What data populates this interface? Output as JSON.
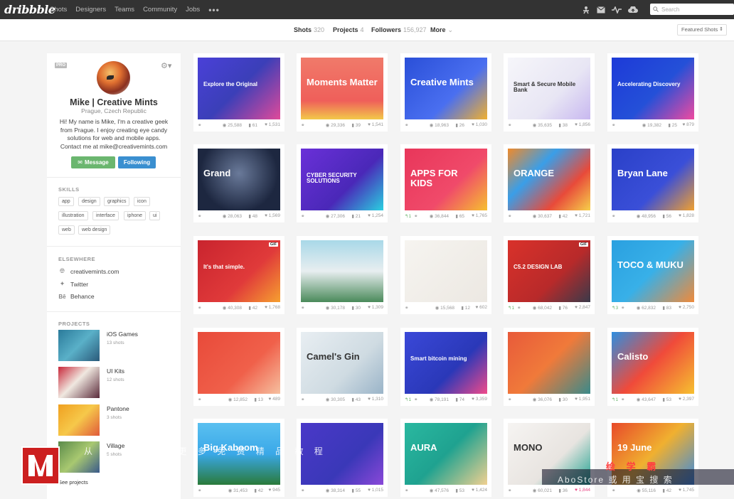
{
  "nav": {
    "logo": "dribbble",
    "links": [
      "Shots",
      "Designers",
      "Teams",
      "Community",
      "Jobs"
    ],
    "more": "•••",
    "search_placeholder": "Search"
  },
  "subnav": {
    "shots_label": "Shots",
    "shots_count": "320",
    "projects_label": "Projects",
    "projects_count": "4",
    "followers_label": "Followers",
    "followers_count": "156,927",
    "more_label": "More",
    "featured_label": "Featured Shots"
  },
  "profile": {
    "badge": "PRO",
    "name": "Mike | Creative Mints",
    "location": "Prague, Czech Republic",
    "bio": "Hi! My name is Mike, I'm a creative geek from Prague. I enjoy creating eye candy solutions for web and mobile apps. Contact me at mike@creativemints.com",
    "message_label": "Message",
    "following_label": "Following",
    "skills_title": "SKILLS",
    "skills": [
      "app",
      "design",
      "graphics",
      "icon",
      "illustration",
      "interface",
      "iphone",
      "ui",
      "web",
      "web design"
    ],
    "elsewhere_title": "ELSEWHERE",
    "elsewhere": [
      {
        "label": "creativemints.com",
        "icon": "globe-icon"
      },
      {
        "label": "Twitter",
        "icon": "twitter-icon"
      },
      {
        "label": "Behance",
        "icon": "behance-icon"
      }
    ],
    "projects_title": "PROJECTS",
    "projects": [
      {
        "title": "iOS Games",
        "count": "13 shots"
      },
      {
        "title": "UI Kits",
        "count": "12 shots"
      },
      {
        "title": "Pantone",
        "count": "3 shots"
      },
      {
        "title": "Village",
        "count": "5 shots"
      }
    ],
    "see_projects": "See projects"
  },
  "shots": [
    {
      "title": "Explore the Original",
      "views": "25,588",
      "comments": "61",
      "likes": "1,531",
      "rebounds": "",
      "gif": false,
      "bg": "#3b3fb8"
    },
    {
      "title": "Moments Matter",
      "views": "29,336",
      "comments": "39",
      "likes": "1,541",
      "rebounds": "",
      "gif": false,
      "bg": "#ef5f5a"
    },
    {
      "title": "Creative Mints",
      "views": "18,963",
      "comments": "26",
      "likes": "1,030",
      "rebounds": "",
      "gif": false,
      "bg": "#3a5fe8"
    },
    {
      "title": "Smart & Secure Mobile Bank",
      "views": "35,635",
      "comments": "38",
      "likes": "1,856",
      "rebounds": "",
      "gif": false,
      "bg": "#f1f1f4"
    },
    {
      "title": "Accelerating Discovery",
      "views": "19,382",
      "comments": "25",
      "likes": "879",
      "rebounds": "",
      "gif": false,
      "bg": "#2450d8"
    },
    {
      "title": "Grand",
      "views": "28,063",
      "comments": "48",
      "likes": "1,569",
      "rebounds": "",
      "gif": false,
      "bg": "#1d2740"
    },
    {
      "title": "CYBER SECURITY SOLUTIONS",
      "views": "27,306",
      "comments": "21",
      "likes": "1,254",
      "rebounds": "",
      "gif": false,
      "bg": "#5030c8"
    },
    {
      "title": "APPS FOR KIDS",
      "views": "36,844",
      "comments": "65",
      "likes": "1,765",
      "rebounds": "1",
      "gif": false,
      "bg": "#e8365a"
    },
    {
      "title": "ORANGE",
      "views": "30,637",
      "comments": "42",
      "likes": "1,721",
      "rebounds": "",
      "gif": false,
      "bg": "#3a9ee8"
    },
    {
      "title": "Bryan Lane",
      "views": "48,956",
      "comments": "56",
      "likes": "1,828",
      "rebounds": "",
      "gif": false,
      "bg": "#3a4fd8"
    },
    {
      "title": "It's that simple.",
      "views": "40,308",
      "comments": "42",
      "likes": "1,768",
      "rebounds": "",
      "gif": true,
      "bg": "#c9242e"
    },
    {
      "title": "",
      "views": "30,178",
      "comments": "30",
      "likes": "1,309",
      "rebounds": "",
      "gif": false,
      "bg": "#e8eef0"
    },
    {
      "title": "",
      "views": "15,568",
      "comments": "12",
      "likes": "602",
      "rebounds": "",
      "gif": false,
      "bg": "#f3f1ee"
    },
    {
      "title": "C5.2 DESIGN LAB",
      "views": "68,042",
      "comments": "76",
      "likes": "2,847",
      "rebounds": "1",
      "gif": true,
      "bg": "#d9312a"
    },
    {
      "title": "TOCO & MUKU",
      "views": "62,832",
      "comments": "83",
      "likes": "2,750",
      "rebounds": "3",
      "gif": false,
      "bg": "#38b0e8"
    },
    {
      "title": "",
      "views": "12,852",
      "comments": "13",
      "likes": "489",
      "rebounds": "",
      "gif": false,
      "bg": "#e84a3a"
    },
    {
      "title": "Camel's Gin",
      "views": "30,305",
      "comments": "43",
      "likes": "1,310",
      "rebounds": "",
      "gif": false,
      "bg": "#dfe6ea"
    },
    {
      "title": "Smart bitcoin mining",
      "views": "78,191",
      "comments": "74",
      "likes": "3,359",
      "rebounds": "1",
      "gif": false,
      "bg": "#3a48d8"
    },
    {
      "title": "",
      "views": "36,076",
      "comments": "30",
      "likes": "1,951",
      "rebounds": "",
      "gif": false,
      "bg": "#e85a3a"
    },
    {
      "title": "Calisto",
      "views": "43,647",
      "comments": "53",
      "likes": "2,397",
      "rebounds": "1",
      "gif": false,
      "bg": "#2e8ee0"
    },
    {
      "title": "Big Kaboom",
      "views": "31,453",
      "comments": "42",
      "likes": "945",
      "rebounds": "",
      "gif": false,
      "bg": "#3aa8e8"
    },
    {
      "title": "",
      "views": "38,314",
      "comments": "55",
      "likes": "1,015",
      "rebounds": "",
      "gif": false,
      "bg": "#3a38b8"
    },
    {
      "title": "AURA",
      "views": "47,576",
      "comments": "53",
      "likes": "1,424",
      "rebounds": "",
      "gif": false,
      "bg": "#1fa290"
    },
    {
      "title": "MONO",
      "views": "60,021",
      "comments": "36",
      "likes": "1,844",
      "rebounds": "",
      "gif": false,
      "bg": "#f6f4f2"
    },
    {
      "title": "19 June",
      "views": "55,116",
      "comments": "42",
      "likes": "1,745",
      "rebounds": "",
      "gif": false,
      "bg": "#e84a2a"
    }
  ],
  "watermark": {
    "line1": "从 方 Y 获 得 更 多 免 费 精 品 教 程",
    "line2": "绘 学 霸",
    "line3": "AboStore 或 用 宝 搜 索"
  },
  "colors": {
    "nav_bg": "#333333",
    "message_btn": "#6bb66f",
    "following_btn": "#3a8fd0",
    "page_bg": "#f4f4f4"
  }
}
